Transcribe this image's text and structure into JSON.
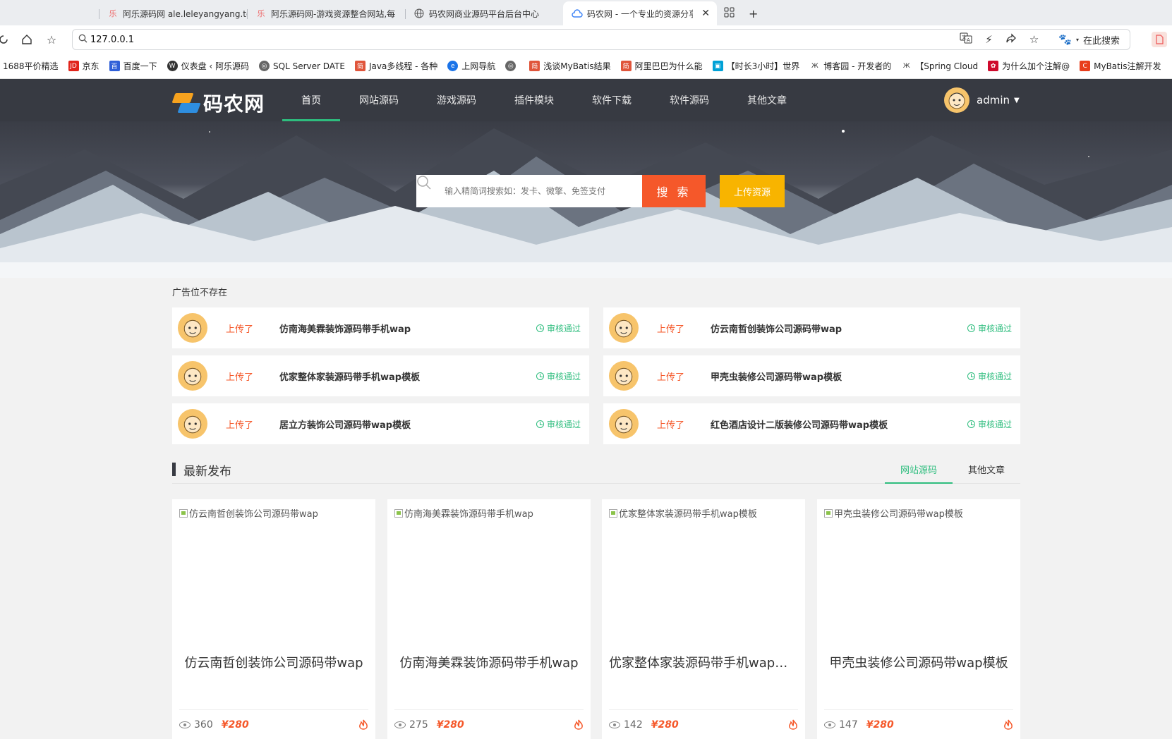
{
  "browser": {
    "tabs": [
      {
        "title": "阿乐源码网 ale.leleyangyang.to",
        "icon": "site-favicon"
      },
      {
        "title": "阿乐源码网-游戏资源整合网站,每",
        "icon": "site-favicon"
      },
      {
        "title": "码农网商业源码平台后台中心",
        "icon": "globe-icon"
      },
      {
        "title": "码农网 - 一个专业的资源分享",
        "icon": "cloud-icon",
        "active": true
      }
    ],
    "address": "127.0.0.1",
    "search_engine_label": "在此搜索",
    "bookmarks": [
      {
        "label": "1688平价精选",
        "color": ""
      },
      {
        "label": "京东",
        "color": "#e1251b"
      },
      {
        "label": "百度一下",
        "color": "#2f5fd8"
      },
      {
        "label": "仪表盘 ‹ 阿乐源码",
        "color": "#333333"
      },
      {
        "label": "SQL Server DATE",
        "color": "#666666"
      },
      {
        "label": "Java多线程 - 各种",
        "color": "#e0553b"
      },
      {
        "label": "上网导航",
        "color": "#1a73e8"
      },
      {
        "label": "",
        "color": "#666666"
      },
      {
        "label": "浅谈MyBatis结果",
        "color": "#e0553b"
      },
      {
        "label": "阿里巴巴为什么能",
        "color": "#e0553b"
      },
      {
        "label": "【时长3小时】世界",
        "color": "#00a1d6"
      },
      {
        "label": "博客园 - 开发者的",
        "color": "#333333"
      },
      {
        "label": "【Spring Cloud",
        "color": "#333333"
      },
      {
        "label": "为什么加个注解@",
        "color": "#cf0a2c"
      },
      {
        "label": "MyBatis注解开发",
        "color": "#e83e1c"
      }
    ]
  },
  "site": {
    "logo_text": "码农网",
    "nav": [
      "首页",
      "网站源码",
      "游戏源码",
      "插件模块",
      "软件下载",
      "软件源码",
      "其他文章"
    ],
    "user": "admin",
    "search_placeholder": "输入精简词搜索如：发卡、微擎、免签支付",
    "search_button": "搜 索",
    "upload_button": "上传资源",
    "ad_text": "广告位不存在",
    "feed_action": "上传了",
    "feed_status": "审核通过",
    "feed": [
      "仿南海美霖装饰源码带手机wap",
      "仿云南哲创装饰公司源码带wap",
      "优家整体家装源码带手机wap模板",
      "甲壳虫装修公司源码带wap模板",
      "居立方装饰公司源码带wap模板",
      "红色酒店设计二版装修公司源码带wap模板"
    ],
    "section_title": "最新发布",
    "section_tabs": [
      "网站源码",
      "其他文章"
    ],
    "cards": [
      {
        "alt": "仿云南哲创装饰公司源码带wap",
        "title": "仿云南哲创装饰公司源码带wap",
        "views": "360",
        "price": "¥280"
      },
      {
        "alt": "仿南海美霖装饰源码带手机wap",
        "title": "仿南海美霖装饰源码带手机wap",
        "views": "275",
        "price": "¥280"
      },
      {
        "alt": "优家整体家装源码带手机wap模板",
        "title": "优家整体家装源码带手机wap模...",
        "views": "142",
        "price": "¥280"
      },
      {
        "alt": "甲壳虫装修公司源码带wap模板",
        "title": "甲壳虫装修公司源码带wap模板",
        "views": "147",
        "price": "¥280"
      }
    ],
    "colors": {
      "nav_bg": "#373a42",
      "accent_green": "#2ebd7e",
      "search_orange": "#f5582a",
      "upload_yellow": "#f8b400"
    }
  }
}
